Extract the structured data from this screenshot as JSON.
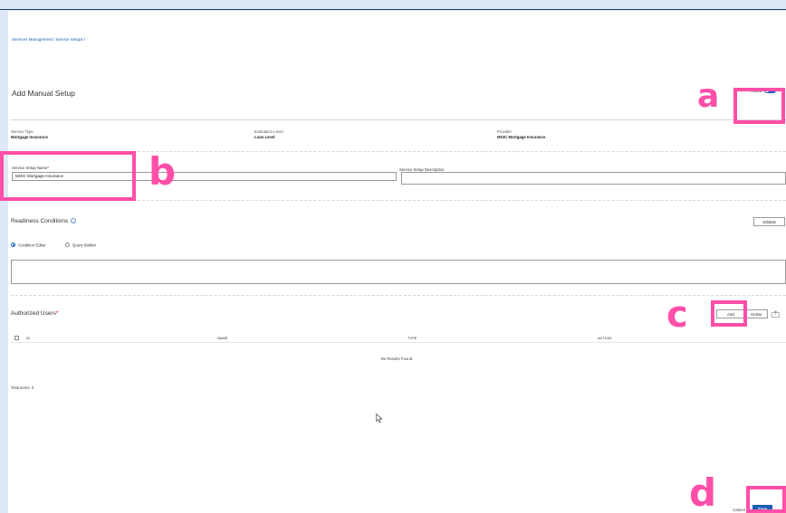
{
  "breadcrumb": "Services Management / Service Setups /",
  "page_title": "Add Manual Setup",
  "active": {
    "label": "Active",
    "toggle_text": "ON",
    "state": "on"
  },
  "info": {
    "service_type_label": "Service Type",
    "service_type_value": "Mortgage Insurance",
    "evaluation_level_label": "Evaluation Level",
    "evaluation_level_value": "Loan Level",
    "provider_label": "Provider",
    "provider_value": "MGIC Mortgage Insurance"
  },
  "form": {
    "setup_name_label": "Service Setup Name",
    "required_mark": "*",
    "setup_name_value": "MGIC Mortgage Insurance",
    "description_label": "Service Setup Description",
    "description_value": ""
  },
  "readiness": {
    "title": "Readiness Conditions",
    "info_icon": "i",
    "validate_label": "Validate",
    "options": [
      "Condition Editor",
      "Query Builder"
    ],
    "selected": "Condition Editor"
  },
  "authorized_users": {
    "title": "Authorized Users",
    "required_mark": "*",
    "add_label": "Add",
    "delete_label": "Delete",
    "columns": [
      "ID",
      "NAME",
      "TYPE",
      "ACTION"
    ],
    "empty_text": "No Results Found.",
    "total_text": "Total items: 0"
  },
  "footer": {
    "cancel_label": "Cancel",
    "save_label": "Save"
  },
  "annotations": {
    "a": "a",
    "b": "b",
    "c": "c",
    "d": "d"
  },
  "colors": {
    "primary": "#1a5fb4",
    "annotation": "#ff4fa8",
    "required": "#d0021b"
  }
}
